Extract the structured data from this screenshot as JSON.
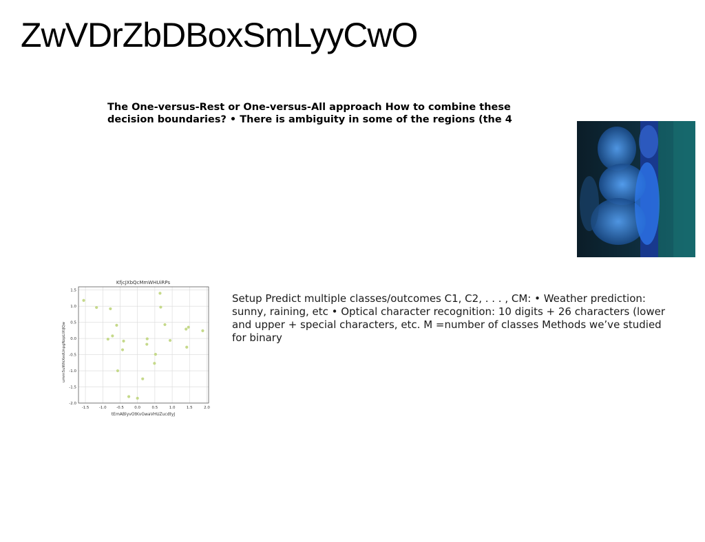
{
  "slide": {
    "title": "ZwVDrZbDBoxSmLyyCwO",
    "bold_text": "The One-versus-Rest or One-versus-All approach How to combine these decision boundaries? • There is ambiguity in some of the regions (the 4",
    "body_text": "Setup Predict multiple classes/outcomes C1, C2, . . . , CM: • Weather prediction: sunny, raining, etc • Optical character recognition: 10 digits + 26 characters (lower and upper + special characters, etc. M =number of classes Methods we’ve studied for binary"
  },
  "colors": {
    "point": "#c5d98a",
    "grid": "#d9d9d9"
  },
  "chart_data": {
    "type": "scatter",
    "title": "KfjcJXbQcMmWHUiRPs",
    "xlabel": "tEmABlyvOtKvGwaVHUZucdtyJ",
    "ylabel": "umrnSuWIkXedUnpgNzpLlXtJQw",
    "xlim": [
      -1.7,
      2.05
    ],
    "ylim": [
      -2.0,
      1.6
    ],
    "xticks": [
      "-1.5",
      "-1.0",
      "-0.5",
      "0.0",
      "0.5",
      "1.0",
      "1.5",
      "2.0"
    ],
    "yticks": [
      "-2.0",
      "-1.5",
      "-1.0",
      "-0.5",
      "0.0",
      "0.5",
      "1.0",
      "1.5"
    ],
    "grid": true,
    "points": [
      {
        "x": -1.55,
        "y": 1.18
      },
      {
        "x": -1.18,
        "y": 0.96
      },
      {
        "x": -0.78,
        "y": 0.92
      },
      {
        "x": -0.6,
        "y": 0.41
      },
      {
        "x": -0.72,
        "y": 0.08
      },
      {
        "x": -0.85,
        "y": -0.02
      },
      {
        "x": -0.4,
        "y": -0.08
      },
      {
        "x": -0.43,
        "y": -0.35
      },
      {
        "x": -0.57,
        "y": -1.0
      },
      {
        "x": 0.65,
        "y": 1.4
      },
      {
        "x": 0.67,
        "y": 0.97
      },
      {
        "x": 0.79,
        "y": 0.43
      },
      {
        "x": 0.28,
        "y": -0.01
      },
      {
        "x": 0.27,
        "y": -0.18
      },
      {
        "x": 0.52,
        "y": -0.49
      },
      {
        "x": 0.49,
        "y": -0.77
      },
      {
        "x": 0.94,
        "y": -0.06
      },
      {
        "x": 1.4,
        "y": 0.29
      },
      {
        "x": 1.47,
        "y": 0.35
      },
      {
        "x": 1.88,
        "y": 0.24
      },
      {
        "x": 1.42,
        "y": -0.27
      },
      {
        "x": 0.15,
        "y": -1.25
      },
      {
        "x": -0.25,
        "y": -1.8
      },
      {
        "x": 0.0,
        "y": -1.85
      }
    ]
  }
}
